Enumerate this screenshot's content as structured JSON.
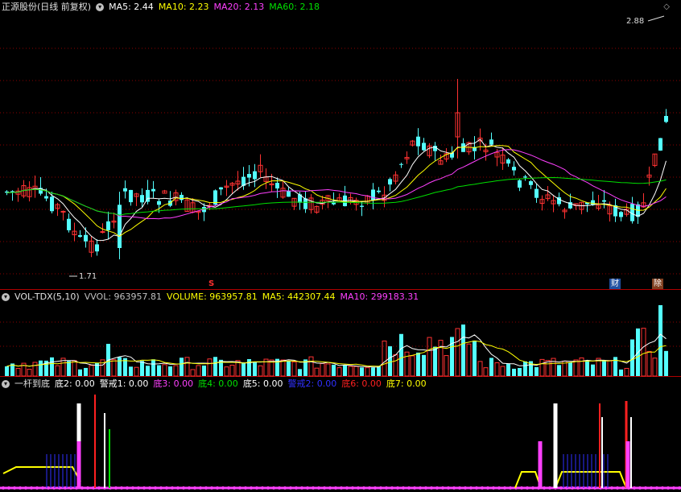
{
  "kline": {
    "title": "正源股份(日线 前复权)",
    "ma": [
      {
        "label": "MA5: 2.44",
        "color": "#ffffff"
      },
      {
        "label": "MA10: 2.23",
        "color": "#ffff00"
      },
      {
        "label": "MA20: 2.13",
        "color": "#ff40ff"
      },
      {
        "label": "MA60: 2.18",
        "color": "#00e000"
      }
    ],
    "high_label": "2.88",
    "low_label": "1.71",
    "marker_s": "S",
    "tag_cai": "财",
    "tag_zhang": "除"
  },
  "volume": {
    "title": "VOL-TDX(5,10)",
    "items": [
      {
        "label": "VVOL: 963957.81",
        "color": "#c0c0c0"
      },
      {
        "label": "VOLUME: 963957.81",
        "color": "#ffff00"
      },
      {
        "label": "MA5: 442307.44",
        "color": "#ffff00"
      },
      {
        "label": "MA10: 299183.31",
        "color": "#ff40ff"
      }
    ]
  },
  "indicator": {
    "title": "一杆到底",
    "items": [
      {
        "label": "底2: 0.00",
        "color": "#ffffff"
      },
      {
        "label": "警戒1: 0.00",
        "color": "#ffffff"
      },
      {
        "label": "底3: 0.00",
        "color": "#ff40ff"
      },
      {
        "label": "底4: 0.00",
        "color": "#00e000"
      },
      {
        "label": "底5: 0.00",
        "color": "#ffffff"
      },
      {
        "label": "警戒2: 0.00",
        "color": "#3030ff"
      },
      {
        "label": "底6: 0.00",
        "color": "#ff2020"
      },
      {
        "label": "底7: 0.00",
        "color": "#ffff00"
      }
    ]
  },
  "colors": {
    "up": "#ff3232",
    "down": "#54ffff",
    "grid": "#8b0000",
    "border": "#b00000"
  }
}
